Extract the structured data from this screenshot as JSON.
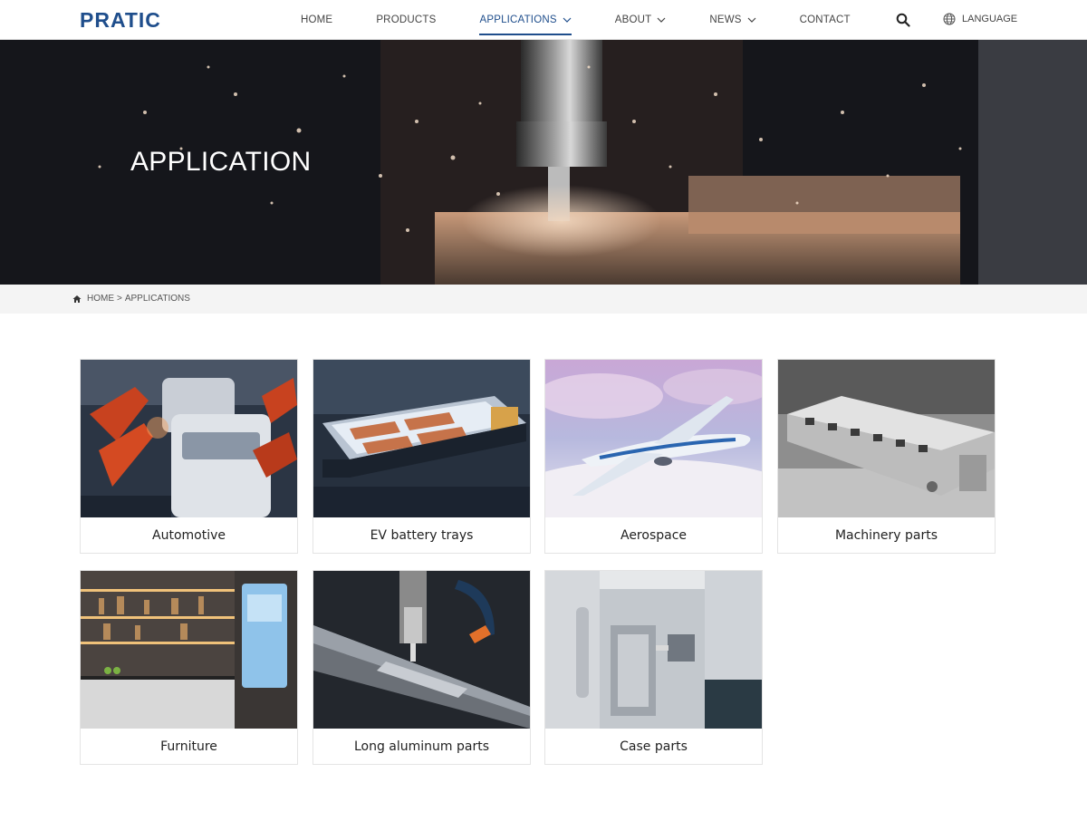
{
  "header": {
    "logo_text": "PRATIC",
    "nav": [
      {
        "label": "HOME",
        "has_dropdown": false,
        "active": false
      },
      {
        "label": "PRODUCTS",
        "has_dropdown": false,
        "active": false
      },
      {
        "label": "APPLICATIONS",
        "has_dropdown": true,
        "active": true
      },
      {
        "label": "ABOUT",
        "has_dropdown": true,
        "active": false
      },
      {
        "label": "NEWS",
        "has_dropdown": true,
        "active": false
      },
      {
        "label": "CONTACT",
        "has_dropdown": false,
        "active": false
      }
    ],
    "language_label": "LANGUAGE",
    "brand_color": "#1f4e8c"
  },
  "hero": {
    "title": "APPLICATION"
  },
  "breadcrumb": {
    "home": "HOME",
    "separator": ">",
    "current": "APPLICATIONS"
  },
  "applications": [
    {
      "label": "Automotive",
      "icon": "automotive-image"
    },
    {
      "label": "EV battery trays",
      "icon": "ev-battery-tray-image"
    },
    {
      "label": "Aerospace",
      "icon": "aerospace-image"
    },
    {
      "label": "Machinery parts",
      "icon": "machinery-parts-image"
    },
    {
      "label": "Furniture",
      "icon": "furniture-image"
    },
    {
      "label": "Long aluminum parts",
      "icon": "long-aluminum-parts-image"
    },
    {
      "label": "Case parts",
      "icon": "case-parts-image"
    }
  ]
}
